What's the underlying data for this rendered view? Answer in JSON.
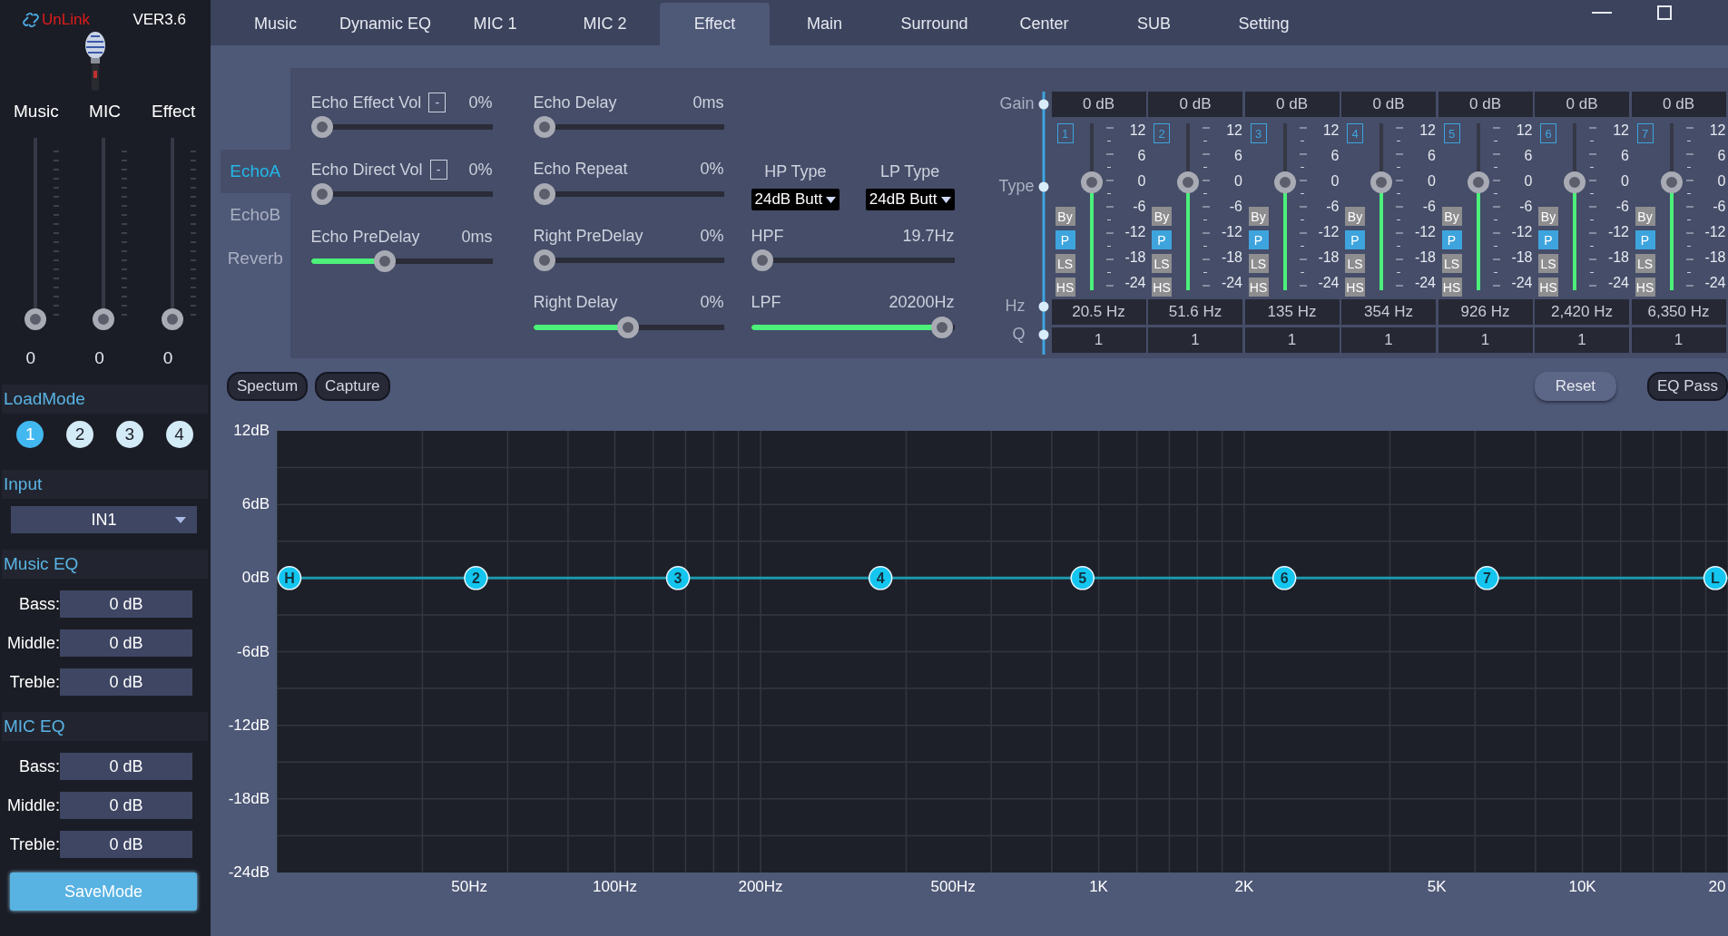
{
  "sidebar": {
    "link_status": "UnLink",
    "version": "VER3.6",
    "channels": [
      {
        "name": "Music",
        "level": 0,
        "value": "0"
      },
      {
        "name": "MIC",
        "level": 0,
        "value": "0"
      },
      {
        "name": "Effect",
        "level": 0,
        "value": "0"
      }
    ],
    "load_mode": {
      "title": "LoadMode",
      "modes": [
        {
          "label": "1",
          "selected": true
        },
        {
          "label": "2",
          "selected": false
        },
        {
          "label": "3",
          "selected": false
        },
        {
          "label": "4",
          "selected": false
        }
      ]
    },
    "input": {
      "title": "Input",
      "value": "IN1"
    },
    "music_eq": {
      "title": "Music EQ",
      "rows": [
        {
          "label": "Bass:",
          "value": "0 dB"
        },
        {
          "label": "Middle:",
          "value": "0 dB"
        },
        {
          "label": "Treble:",
          "value": "0 dB"
        }
      ]
    },
    "mic_eq": {
      "title": "MIC EQ",
      "rows": [
        {
          "label": "Bass:",
          "value": "0 dB"
        },
        {
          "label": "Middle:",
          "value": "0 dB"
        },
        {
          "label": "Treble:",
          "value": "0 dB"
        }
      ]
    },
    "save_button": "SaveMode"
  },
  "tabs": [
    {
      "label": "Music",
      "selected": false
    },
    {
      "label": "Dynamic EQ",
      "selected": false
    },
    {
      "label": "MIC 1",
      "selected": false
    },
    {
      "label": "MIC 2",
      "selected": false
    },
    {
      "label": "Effect",
      "selected": true
    },
    {
      "label": "Main",
      "selected": false
    },
    {
      "label": "Surround",
      "selected": false
    },
    {
      "label": "Center",
      "selected": false
    },
    {
      "label": "SUB",
      "selected": false
    },
    {
      "label": "Setting",
      "selected": false
    }
  ],
  "effect": {
    "subtabs": [
      {
        "label": "EchoA",
        "selected": true
      },
      {
        "label": "EchoB",
        "selected": false
      },
      {
        "label": "Reverb",
        "selected": false
      }
    ],
    "columns": [
      [
        {
          "kind": "slider",
          "label": "Echo Effect Vol",
          "box": "-",
          "value": "0%",
          "level": 0
        },
        {
          "kind": "slider",
          "label": "Echo Direct Vol",
          "box": "-",
          "value": "0%",
          "level": 0
        },
        {
          "kind": "slider",
          "label": "Echo PreDelay",
          "value": "0ms",
          "level": 0.4
        }
      ],
      [
        {
          "kind": "slider",
          "label": "Echo Delay",
          "value": "0ms",
          "level": 0
        },
        {
          "kind": "slider",
          "label": "Echo Repeat",
          "value": "0%",
          "level": 0
        },
        {
          "kind": "slider",
          "label": "Right PreDelay",
          "value": "0%",
          "level": 0
        },
        {
          "kind": "slider",
          "label": "Right Delay",
          "value": "0%",
          "level": 0.5
        }
      ],
      [
        {
          "kind": "type_select",
          "selects": [
            {
              "label": "HP Type",
              "value": "24dB Butt"
            },
            {
              "label": "LP Type",
              "value": "24dB Butt"
            }
          ]
        },
        {
          "kind": "slider",
          "label": "HPF",
          "value": "19.7Hz",
          "level": 0
        },
        {
          "kind": "slider",
          "label": "LPF",
          "value": "20200Hz",
          "level": 1
        }
      ]
    ]
  },
  "eq": {
    "row_labels": [
      "Gain",
      "Type",
      "Hz",
      "Q"
    ],
    "bands": [
      {
        "number": "1",
        "gain": "0 dB",
        "types": [
          {
            "label": "By",
            "selected": false
          },
          {
            "label": "P",
            "selected": true
          },
          {
            "label": "LS",
            "selected": false
          },
          {
            "label": "HS",
            "selected": false
          }
        ],
        "level": 0.667,
        "scale": [
          "12",
          "6",
          "0",
          "-6",
          "-12",
          "-18",
          "-24"
        ],
        "hz": "20.5 Hz",
        "q": "1"
      },
      {
        "number": "2",
        "gain": "0 dB",
        "types": [
          {
            "label": "By",
            "selected": false
          },
          {
            "label": "P",
            "selected": true
          },
          {
            "label": "LS",
            "selected": false
          },
          {
            "label": "HS",
            "selected": false
          }
        ],
        "level": 0.667,
        "scale": [
          "12",
          "6",
          "0",
          "-6",
          "-12",
          "-18",
          "-24"
        ],
        "hz": "51.6 Hz",
        "q": "1"
      },
      {
        "number": "3",
        "gain": "0 dB",
        "types": [
          {
            "label": "By",
            "selected": false
          },
          {
            "label": "P",
            "selected": true
          },
          {
            "label": "LS",
            "selected": false
          },
          {
            "label": "HS",
            "selected": false
          }
        ],
        "level": 0.667,
        "scale": [
          "12",
          "6",
          "0",
          "-6",
          "-12",
          "-18",
          "-24"
        ],
        "hz": "135 Hz",
        "q": "1"
      },
      {
        "number": "4",
        "gain": "0 dB",
        "types": [
          {
            "label": "By",
            "selected": false
          },
          {
            "label": "P",
            "selected": true
          },
          {
            "label": "LS",
            "selected": false
          },
          {
            "label": "HS",
            "selected": false
          }
        ],
        "level": 0.667,
        "scale": [
          "12",
          "6",
          "0",
          "-6",
          "-12",
          "-18",
          "-24"
        ],
        "hz": "354 Hz",
        "q": "1"
      },
      {
        "number": "5",
        "gain": "0 dB",
        "types": [
          {
            "label": "By",
            "selected": false
          },
          {
            "label": "P",
            "selected": true
          },
          {
            "label": "LS",
            "selected": false
          },
          {
            "label": "HS",
            "selected": false
          }
        ],
        "level": 0.667,
        "scale": [
          "12",
          "6",
          "0",
          "-6",
          "-12",
          "-18",
          "-24"
        ],
        "hz": "926 Hz",
        "q": "1"
      },
      {
        "number": "6",
        "gain": "0 dB",
        "types": [
          {
            "label": "By",
            "selected": false
          },
          {
            "label": "P",
            "selected": true
          },
          {
            "label": "LS",
            "selected": false
          },
          {
            "label": "HS",
            "selected": false
          }
        ],
        "level": 0.667,
        "scale": [
          "12",
          "6",
          "0",
          "-6",
          "-12",
          "-18",
          "-24"
        ],
        "hz": "2,420 Hz",
        "q": "1"
      },
      {
        "number": "7",
        "gain": "0 dB",
        "types": [
          {
            "label": "By",
            "selected": false
          },
          {
            "label": "P",
            "selected": true
          },
          {
            "label": "LS",
            "selected": false
          },
          {
            "label": "HS",
            "selected": false
          }
        ],
        "level": 0.667,
        "scale": [
          "12",
          "6",
          "0",
          "-6",
          "-12",
          "-18",
          "-24"
        ],
        "hz": "6,350 Hz",
        "q": "1"
      }
    ]
  },
  "buttons": [
    {
      "label": "Spectum",
      "kind": "outline"
    },
    {
      "label": "Capture",
      "kind": "outline"
    },
    {
      "label": "Reset",
      "kind": "filled"
    },
    {
      "label": "EQ Pass",
      "kind": "outline"
    }
  ],
  "graph": {
    "y_labels": [
      "12dB",
      "6dB",
      "0dB",
      "-6dB",
      "-12dB",
      "-18dB",
      "-24dB"
    ],
    "x_labels": [
      "50Hz",
      "100Hz",
      "200Hz",
      "500Hz",
      "1K",
      "2K",
      "5K",
      "10K",
      "20"
    ],
    "nodes": [
      {
        "label": "H"
      },
      {
        "label": "2"
      },
      {
        "label": "3"
      },
      {
        "label": "4"
      },
      {
        "label": "5"
      },
      {
        "label": "6"
      },
      {
        "label": "7"
      },
      {
        "label": "L"
      }
    ]
  }
}
